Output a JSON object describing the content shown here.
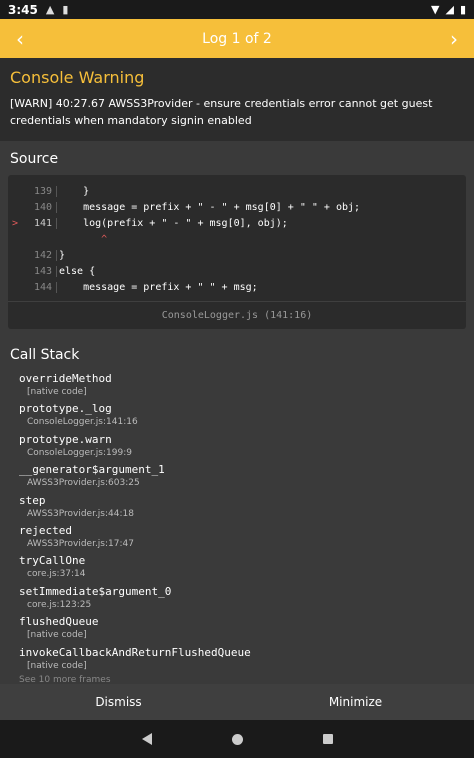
{
  "status": {
    "time": "3:45",
    "left_icons": [
      "a-icon",
      "sd-card-icon"
    ],
    "right_icons": [
      "wifi-icon",
      "signal-icon",
      "battery-icon"
    ]
  },
  "header": {
    "title": "Log 1 of 2",
    "prev_icon": "chevron-left-icon",
    "next_icon": "chevron-right-icon",
    "color": "#f6bf3a"
  },
  "warning": {
    "title": "Console Warning",
    "message": "[WARN] 40:27.67 AWSS3Provider - ensure credentials error cannot get guest credentials when mandatory signin enabled"
  },
  "source": {
    "title": "Source",
    "lines": [
      {
        "num": "139",
        "code": "    }",
        "active": false
      },
      {
        "num": "140",
        "code": "    message = prefix + \" - \" + msg[0] + \" \" + obj;",
        "active": false
      },
      {
        "num": "141",
        "code": "    log(prefix + \" - \" + msg[0], obj);",
        "active": true,
        "marker": ">"
      },
      {
        "num": "",
        "code": "       ^",
        "active": false,
        "caret": true
      },
      {
        "num": "142",
        "code": "}",
        "active": false
      },
      {
        "num": "143",
        "code": "else {",
        "active": false
      },
      {
        "num": "144",
        "code": "    message = prefix + \" \" + msg;",
        "active": false
      }
    ],
    "file": "ConsoleLogger.js (141:16)"
  },
  "call_stack": {
    "title": "Call Stack",
    "frames": [
      {
        "fn": "overrideMethod",
        "loc": "[native code]"
      },
      {
        "fn": "prototype._log",
        "loc": "ConsoleLogger.js:141:16"
      },
      {
        "fn": "prototype.warn",
        "loc": "ConsoleLogger.js:199:9"
      },
      {
        "fn": "__generator$argument_1",
        "loc": "AWSS3Provider.js:603:25"
      },
      {
        "fn": "step",
        "loc": "AWSS3Provider.js:44:18"
      },
      {
        "fn": "rejected",
        "loc": "AWSS3Provider.js:17:47"
      },
      {
        "fn": "tryCallOne",
        "loc": "core.js:37:14"
      },
      {
        "fn": "setImmediate$argument_0",
        "loc": "core.js:123:25"
      },
      {
        "fn": "flushedQueue",
        "loc": "[native code]"
      },
      {
        "fn": "invokeCallbackAndReturnFlushedQueue",
        "loc": "[native code]"
      }
    ],
    "more": "See 10 more frames"
  },
  "footer": {
    "dismiss": "Dismiss",
    "minimize": "Minimize"
  },
  "navbar": {
    "icons": [
      "back-icon",
      "home-icon",
      "recents-icon"
    ]
  }
}
